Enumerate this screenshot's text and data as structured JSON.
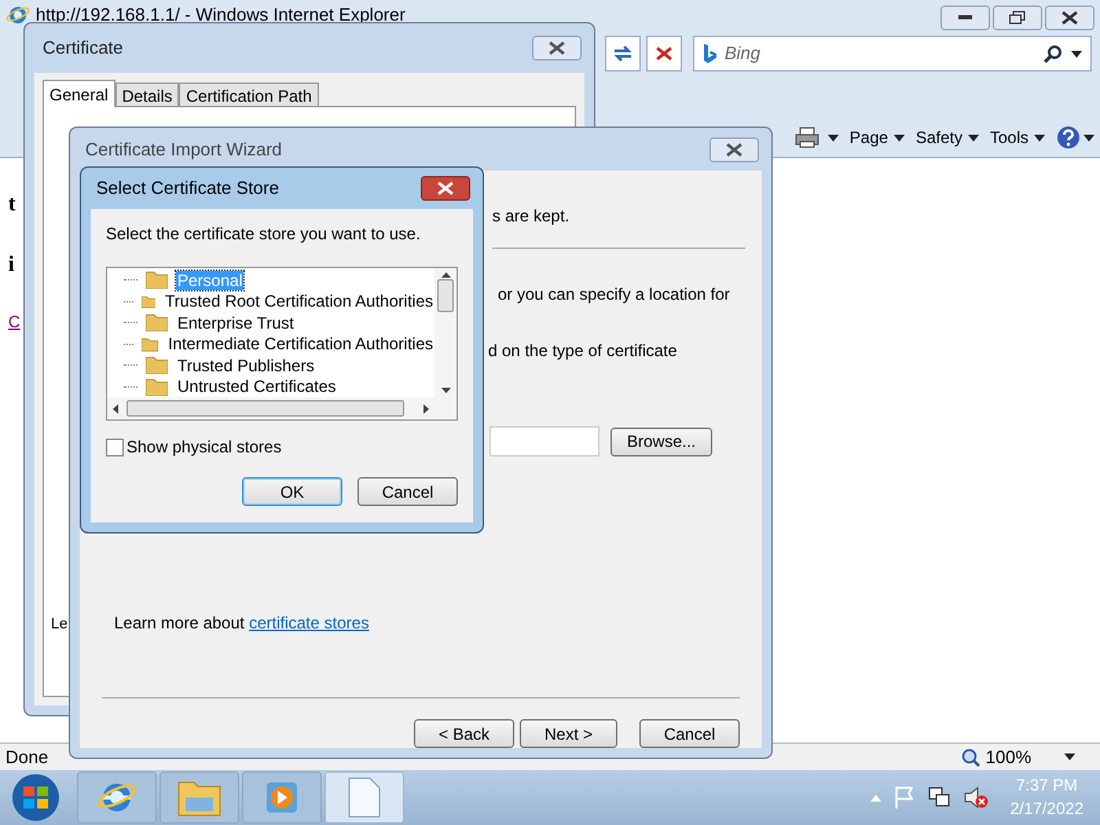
{
  "browser": {
    "title": "http://192.168.1.1/ - Windows Internet Explorer",
    "search": {
      "placeholder": "Bing"
    },
    "commands": [
      "Page",
      "Safety",
      "Tools"
    ],
    "page_fragments": [
      "t",
      "i",
      "C"
    ],
    "status": "Done",
    "zoom": "100%"
  },
  "certificate_window": {
    "title": "Certificate",
    "tabs": [
      {
        "label": "General",
        "selected": true
      },
      {
        "label": "Details",
        "selected": false
      },
      {
        "label": "Certification Path",
        "selected": false
      }
    ],
    "fragment": "Le"
  },
  "import_wizard": {
    "title": "Certificate Import Wizard",
    "texts": [
      "s are kept.",
      "or you can specify a location for",
      "d on the type of certificate"
    ],
    "browse": "Browse...",
    "learn_more": {
      "text": "Learn more about",
      "link": "certificate stores"
    },
    "buttons": [
      "< Back",
      "Next >",
      "Cancel"
    ]
  },
  "store_dialog": {
    "title": "Select Certificate Store",
    "prompt": "Select the certificate store you want to use.",
    "stores": [
      {
        "name": "Personal",
        "selected": true
      },
      {
        "name": "Trusted Root Certification Authorities",
        "selected": false
      },
      {
        "name": "Enterprise Trust",
        "selected": false
      },
      {
        "name": "Intermediate Certification Authorities",
        "selected": false
      },
      {
        "name": "Trusted Publishers",
        "selected": false
      },
      {
        "name": "Untrusted Certificates",
        "selected": false
      }
    ],
    "show_physical": {
      "label": "Show physical stores",
      "checked": false
    },
    "buttons": [
      {
        "label": "OK",
        "default": true
      },
      {
        "label": "Cancel",
        "default": false
      }
    ]
  },
  "taskbar": {
    "apps": [
      {
        "kind": "browser"
      },
      {
        "kind": "folder"
      },
      {
        "kind": "media"
      },
      {
        "kind": "document"
      }
    ],
    "time": "7:37 PM",
    "date": "2/17/2022"
  }
}
